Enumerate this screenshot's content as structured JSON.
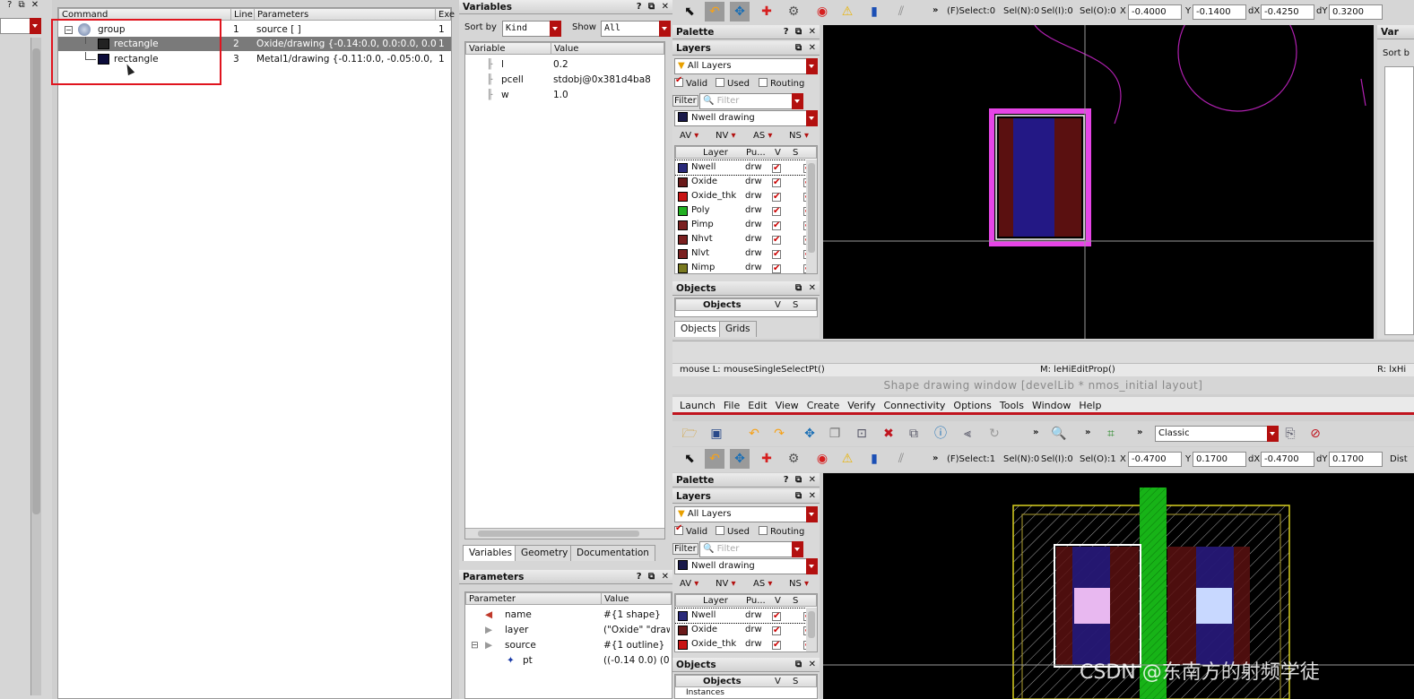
{
  "command_tree": {
    "headers": [
      "Command",
      "Line",
      "Parameters",
      "Exe"
    ],
    "rows": [
      {
        "command": "group",
        "line": "1",
        "params": "source [ ]",
        "exe": "1"
      },
      {
        "command": "rectangle",
        "line": "2",
        "params": "Oxide/drawing {-0.14:0.0, 0.0:0.0, 0.0:0....",
        "exe": "1"
      },
      {
        "command": "rectangle",
        "line": "3",
        "params": "Metal1/drawing {-0.11:0.0, -0.05:0.0, -0....",
        "exe": "1"
      }
    ]
  },
  "variables": {
    "title": "Variables",
    "sort_by_label": "Sort by",
    "sort_by_value": "Kind",
    "show_label": "Show",
    "show_value": "All",
    "headers": [
      "Variable",
      "Value"
    ],
    "rows": [
      {
        "name": "l",
        "value": "0.2"
      },
      {
        "name": "pcell",
        "value": "stdobj@0x381d4ba8"
      },
      {
        "name": "w",
        "value": "1.0"
      }
    ],
    "tabs": [
      "Variables",
      "Geometry",
      "Documentation"
    ]
  },
  "parameters": {
    "title": "Parameters",
    "headers": [
      "Parameter",
      "Value"
    ],
    "rows": [
      {
        "name": "name",
        "value": "#{1 shape}"
      },
      {
        "name": "layer",
        "value": "(\"Oxide\" \"draw"
      },
      {
        "name": "source",
        "value": "#{1 outline}"
      },
      {
        "name": "pt",
        "value": "((-0.14 0.0) (0.0"
      }
    ]
  },
  "top_window": {
    "status": {
      "fselect": "(F)Select:0",
      "seln": "Sel(N):0",
      "seli": "Sel(I):0",
      "selo": "Sel(O):0"
    },
    "x_label": "X",
    "x": "-0.4000",
    "y_label": "Y",
    "y": "-0.1400",
    "dx_label": "dX",
    "dx": "-0.4250",
    "dy_label": "dY",
    "dy": "0.3200",
    "palette": "Palette",
    "layers": "Layers",
    "all_layers": "All Layers",
    "valid": "Valid",
    "used": "Used",
    "routing": "Routing",
    "filter_label": "Filter",
    "filter_placeholder": "Filter",
    "current_layer": "Nwell drawing",
    "vis_cols": [
      "AV",
      "NV",
      "AS",
      "NS"
    ],
    "layer_headers": [
      "Layer",
      "Pu...",
      "V",
      "S"
    ],
    "layer_list": [
      {
        "name": "Nwell",
        "purpose": "drw",
        "color": "#2a2a7a"
      },
      {
        "name": "Oxide",
        "purpose": "drw",
        "color": "#6a1a1a"
      },
      {
        "name": "Oxide_thk",
        "purpose": "drw",
        "color": "#c81414"
      },
      {
        "name": "Poly",
        "purpose": "drw",
        "color": "#22b022"
      },
      {
        "name": "Pimp",
        "purpose": "drw",
        "color": "#7a2020"
      },
      {
        "name": "Nhvt",
        "purpose": "drw",
        "color": "#7a2020"
      },
      {
        "name": "Nlvt",
        "purpose": "drw",
        "color": "#7a2020"
      },
      {
        "name": "Nimp",
        "purpose": "drw",
        "color": "#7a7a20"
      }
    ],
    "objects": "Objects",
    "objects_headers": [
      "Objects",
      "V",
      "S"
    ],
    "bottom_tabs": [
      "Objects",
      "Grids"
    ],
    "right_panel_title": "Var",
    "right_panel_sort": "Sort b"
  },
  "statusbar": {
    "mouse_l": "mouse L: mouseSingleSelectPt()",
    "mouse_m": "M: leHiEditProp()",
    "mouse_r": "R: lxHi"
  },
  "bottom_window": {
    "title": "Shape drawing window [develLib * nmos_initial layout]",
    "menus": [
      "Launch",
      "File",
      "Edit",
      "View",
      "Create",
      "Verify",
      "Connectivity",
      "Options",
      "Tools",
      "Window",
      "Help"
    ],
    "workspace": "Classic",
    "status": {
      "fselect": "(F)Select:1",
      "seln": "Sel(N):0",
      "seli": "Sel(I):0",
      "selo": "Sel(O):1"
    },
    "x_label": "X",
    "x": "-0.4700",
    "y_label": "Y",
    "y": "0.1700",
    "dx_label": "dX",
    "dx": "-0.4700",
    "dy_label": "dY",
    "dy": "0.1700",
    "dist_label": "Dist",
    "palette": "Palette",
    "layers": "Layers",
    "all_layers": "All Layers",
    "valid": "Valid",
    "used": "Used",
    "routing": "Routing",
    "filter_label": "Filter",
    "filter_placeholder": "Filter",
    "current_layer": "Nwell drawing",
    "vis_cols": [
      "AV",
      "NV",
      "AS",
      "NS"
    ],
    "layer_headers": [
      "Layer",
      "Pu...",
      "V",
      "S"
    ],
    "layer_list": [
      {
        "name": "Nwell",
        "purpose": "drw",
        "color": "#2a2a7a"
      },
      {
        "name": "Oxide",
        "purpose": "drw",
        "color": "#6a1a1a"
      },
      {
        "name": "Oxide_thk",
        "purpose": "drw",
        "color": "#c81414"
      }
    ],
    "objects": "Objects",
    "objects_headers": [
      "Objects",
      "V",
      "S"
    ],
    "instances": "Instances"
  },
  "watermark": "CSDN @东南方的射频学徒",
  "colors": {
    "accent": "#b3100f",
    "highlight_box": "#e0141e",
    "selection": "#7a7a7a"
  }
}
